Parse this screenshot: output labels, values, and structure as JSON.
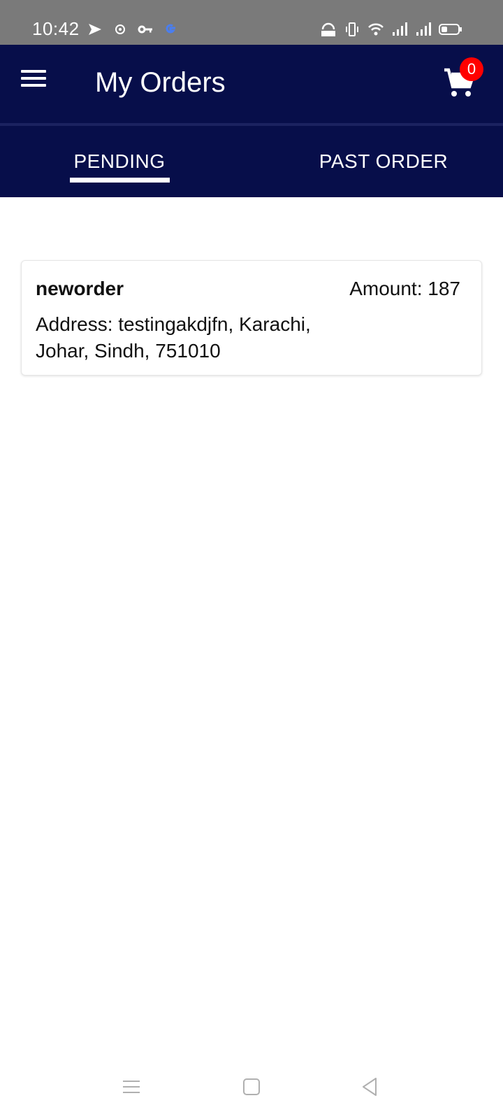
{
  "status_bar": {
    "time": "10:42",
    "left_icons": [
      "messenger-icon",
      "settings-app-icon",
      "key-icon",
      "google-icon"
    ],
    "right_icons": [
      "vpn-icon",
      "vibrate-icon",
      "wifi-icon",
      "signal-icon",
      "signal-icon-2",
      "battery-icon"
    ]
  },
  "app_bar": {
    "title": "My Orders",
    "cart_count": "0",
    "background": "#070e4a"
  },
  "tabs": [
    {
      "label": "PENDING",
      "selected": true
    },
    {
      "label": "PAST ORDER",
      "selected": false
    }
  ],
  "orders": [
    {
      "name": "neworder",
      "amount": "Amount: 187",
      "address": "Address: testingakdjfn, Karachi, Johar, Sindh, 751010"
    }
  ],
  "colors": {
    "accent": "#070e4a",
    "badge": "#ff0000",
    "status_bar": "#7a7a7a"
  }
}
